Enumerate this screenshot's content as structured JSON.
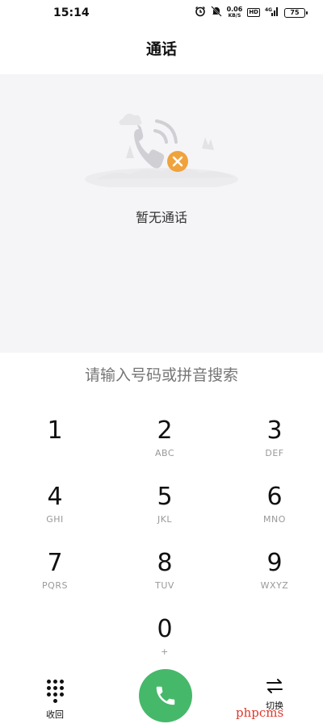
{
  "status_bar": {
    "time": "15:14",
    "net_speed_value": "0.06",
    "net_speed_unit": "KB/S",
    "hd_label": "HD",
    "signal_label": "4G",
    "battery": "75",
    "icons": [
      "alarm-icon",
      "mute-icon",
      "hd-icon",
      "signal-icon",
      "battery-icon"
    ]
  },
  "header": {
    "title": "通话"
  },
  "empty_state": {
    "text": "暂无通话",
    "icon": "missed-call-icon"
  },
  "dialer": {
    "placeholder": "请输入号码或拼音搜索",
    "keys": [
      {
        "digit": "1",
        "letters": ""
      },
      {
        "digit": "2",
        "letters": "ABC"
      },
      {
        "digit": "3",
        "letters": "DEF"
      },
      {
        "digit": "4",
        "letters": "GHI"
      },
      {
        "digit": "5",
        "letters": "JKL"
      },
      {
        "digit": "6",
        "letters": "MNO"
      },
      {
        "digit": "7",
        "letters": "PQRS"
      },
      {
        "digit": "8",
        "letters": "TUV"
      },
      {
        "digit": "9",
        "letters": "WXYZ"
      },
      {
        "digit": "0",
        "letters": "+"
      }
    ]
  },
  "bottom_bar": {
    "collapse_label": "收回",
    "switch_label": "切换",
    "call_icon": "phone-icon"
  },
  "watermark": "phpcms",
  "colors": {
    "call_green": "#46b86a",
    "accent_orange": "#f0a23c",
    "hint_grey": "#999999"
  }
}
